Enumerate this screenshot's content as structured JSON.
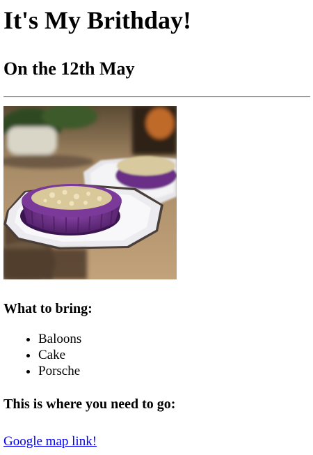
{
  "header": {
    "title": "It's My Brithday!",
    "subtitle": "On the 12th May"
  },
  "image": {
    "icon": "cake-photo",
    "colors": {
      "background": "#b89a78",
      "plate": "#e9e9eb",
      "cake": "#6b2e86",
      "topping": "#d8c9a0",
      "foliage": "#2f4a22"
    }
  },
  "bring": {
    "heading": "What to bring:",
    "items": [
      "Baloons",
      "Cake",
      "Porsche"
    ]
  },
  "location": {
    "heading": "This is where you need to go:",
    "link_text": "Google map link!"
  }
}
